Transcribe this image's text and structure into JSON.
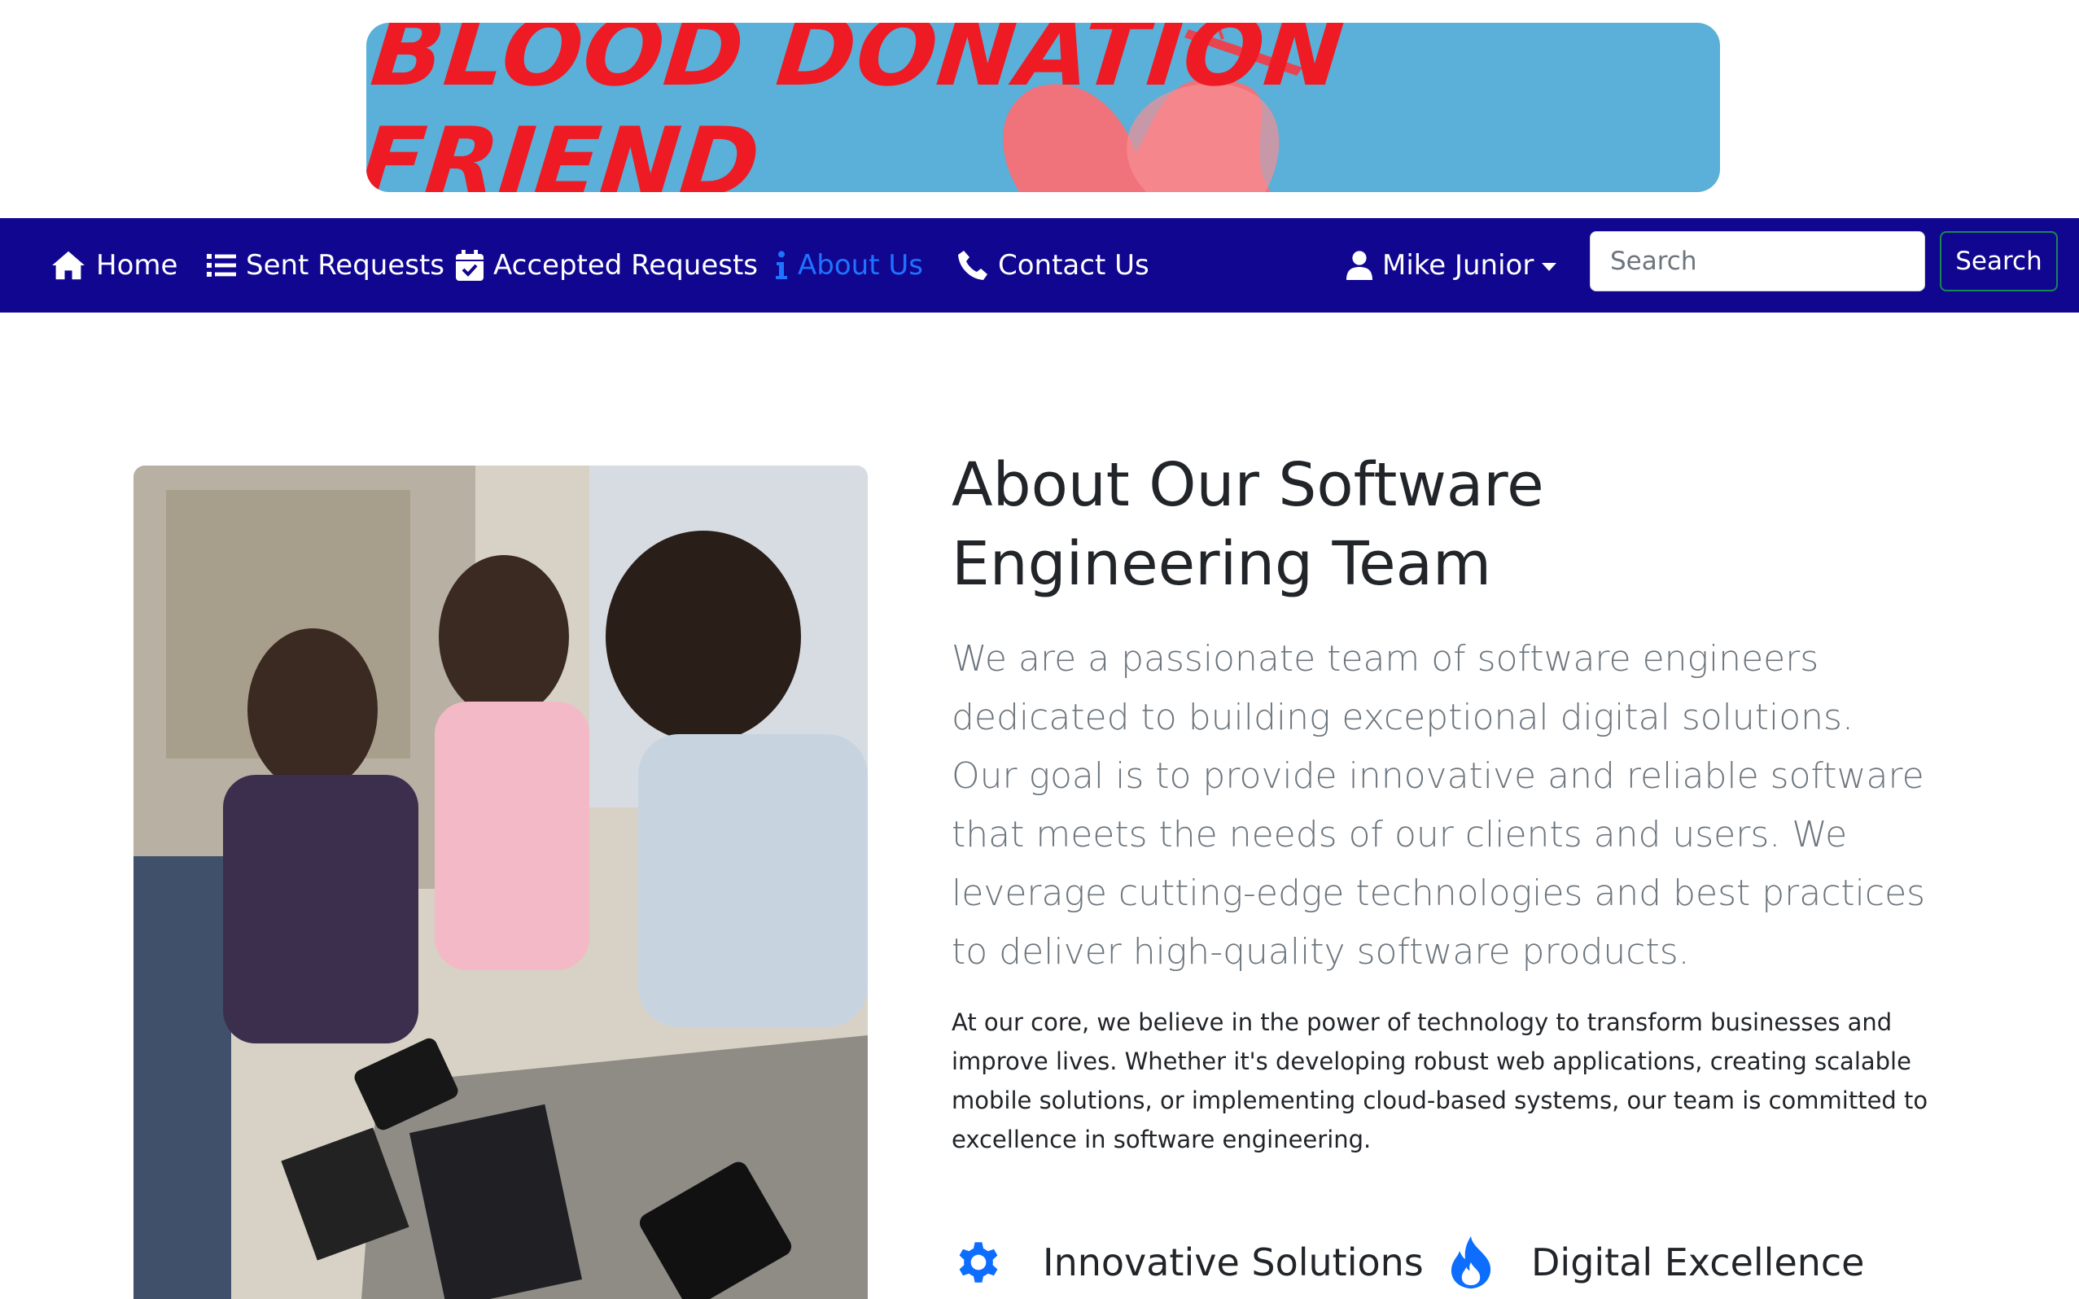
{
  "banner": {
    "title": "BLOOD DONATION FRIEND",
    "background_color": "#5ab0d8",
    "title_color": "#ee1b24"
  },
  "navbar": {
    "background_color": "#11068f",
    "items": [
      {
        "label": "Home",
        "icon": "home-icon"
      },
      {
        "label": "Sent Requests",
        "icon": "list-icon"
      },
      {
        "label": "Accepted Requests",
        "icon": "calendar-check-icon"
      },
      {
        "label": "About Us",
        "icon": "info-icon",
        "active": true
      },
      {
        "label": "Contact Us",
        "icon": "phone-icon"
      }
    ],
    "user": {
      "name": "Mike Junior",
      "icon": "user-icon"
    },
    "search": {
      "placeholder": "Search",
      "button_label": "Search"
    },
    "active_color": "#1e73ff"
  },
  "about": {
    "title": "About Our Software Engineering Team",
    "lead": "We are a passionate team of software engineers dedicated to building exceptional digital solutions. Our goal is to provide innovative and reliable software that meets the needs of our clients and users. We leverage cutting-edge technologies and best practices to deliver high-quality software products.",
    "body": "At our core, we believe in the power of technology to transform businesses and improve lives. Whether it's developing robust web applications, creating scalable mobile solutions, or implementing cloud-based systems, our team is committed to excellence in software engineering.",
    "features": [
      {
        "label": "Innovative Solutions",
        "icon": "gear-icon"
      },
      {
        "label": "Digital Excellence",
        "icon": "fire-icon"
      }
    ],
    "feature_icon_color": "#0d6efd"
  }
}
